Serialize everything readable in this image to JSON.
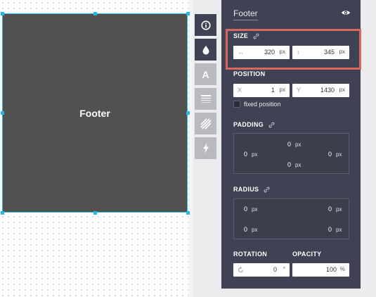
{
  "canvas": {
    "element_label": "Footer"
  },
  "toolbar": {
    "tools": [
      {
        "name": "info"
      },
      {
        "name": "fill"
      },
      {
        "name": "text",
        "glyph": "A"
      },
      {
        "name": "border"
      },
      {
        "name": "pattern"
      },
      {
        "name": "action"
      }
    ]
  },
  "panel": {
    "title": "Footer",
    "size": {
      "label": "SIZE",
      "width": "320",
      "height": "345",
      "unit": "px"
    },
    "position": {
      "label": "POSITION",
      "x_prefix": "X",
      "x": "1",
      "y_prefix": "Y",
      "y": "1430",
      "unit": "px",
      "fixed_label": "fixed position"
    },
    "padding": {
      "label": "PADDING",
      "top": "0",
      "left": "0",
      "right": "0",
      "bottom": "0",
      "unit": "px"
    },
    "radius": {
      "label": "RADIUS",
      "top_left": "0",
      "top_right": "0",
      "bottom_left": "0",
      "bottom_right": "0",
      "unit": "px"
    },
    "rotation": {
      "label": "ROTATION",
      "value": "0",
      "unit": "°"
    },
    "opacity": {
      "label": "OPACITY",
      "value": "100",
      "unit": "%"
    }
  },
  "colors": {
    "panel_bg": "#3e4252",
    "selection": "#29b6e6",
    "element_fill": "#535150",
    "highlight": "#d9675e"
  }
}
